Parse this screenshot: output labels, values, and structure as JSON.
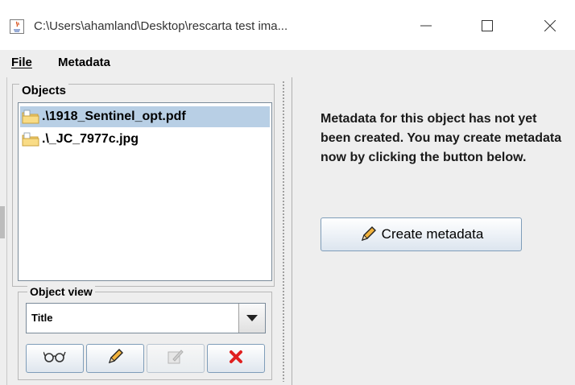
{
  "window": {
    "title": "C:\\Users\\ahamland\\Desktop\\rescarta test ima...",
    "minimize_icon": "minimize-icon",
    "maximize_icon": "maximize-icon",
    "close_icon": "close-icon"
  },
  "menubar": {
    "file_label": "File",
    "metadata_label": "Metadata"
  },
  "objects_panel": {
    "legend": "Objects",
    "items": [
      {
        "label": ".\\1918_Sentinel_opt.pdf",
        "selected": true,
        "icon": "folder-icon"
      },
      {
        "label": ".\\_JC_7977c.jpg",
        "selected": false,
        "icon": "folder-icon"
      }
    ]
  },
  "object_view": {
    "legend": "Object view",
    "selected_value": "Title"
  },
  "toolbar": {
    "buttons": [
      {
        "icon": "glasses-icon",
        "enabled": true
      },
      {
        "icon": "pencil-icon",
        "enabled": true
      },
      {
        "icon": "edit-disabled-icon",
        "enabled": false
      },
      {
        "icon": "delete-icon",
        "enabled": true
      }
    ]
  },
  "main": {
    "message": "Metadata for this object has not yet been created. You may create metadata now by clicking the button below.",
    "create_button_label": "Create metadata"
  },
  "colors": {
    "selection": "#b8cfe5",
    "delete_red": "#e02020",
    "pencil_orange": "#e8a020"
  }
}
